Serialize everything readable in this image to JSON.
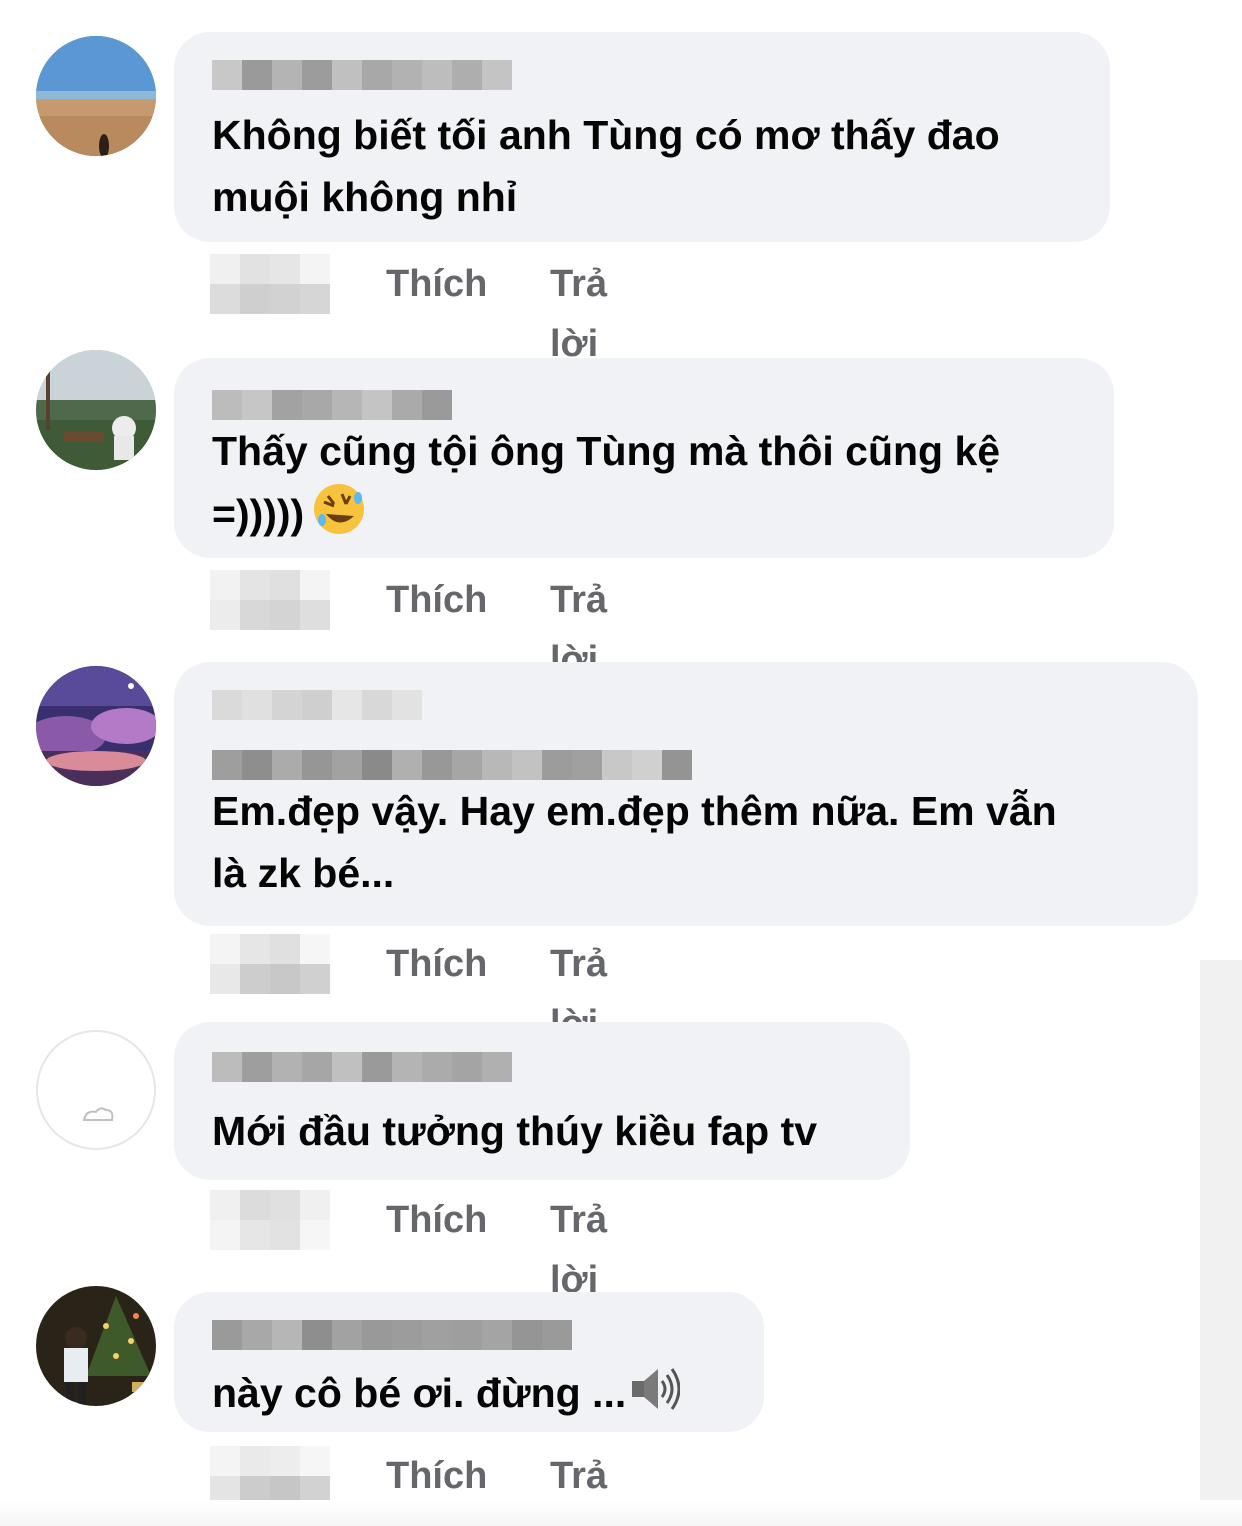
{
  "comments": [
    {
      "author": "",
      "text": "Không biết tối anh Tùng có mơ thấy đao\nmuội không nhỉ",
      "like_label": "Thích",
      "reply_label": "Trả lời"
    },
    {
      "author": "",
      "text": "Thấy cũng tội ông Tùng mà thôi cũng kệ\n=)))))",
      "emoji": "rolling-on-floor-laughing-emoji",
      "like_label": "Thích",
      "reply_label": "Trả lời"
    },
    {
      "author": "",
      "text": "Em.đẹp vậy. Hay em.đẹp thêm nữa. Em vẫn\nlà zk bé...",
      "like_label": "Thích",
      "reply_label": "Trả lời"
    },
    {
      "author": "",
      "text": "Mới đầu tưởng thúy kiều fap tv",
      "like_label": "Thích",
      "reply_label": "Trả lời"
    },
    {
      "author": "",
      "text": "này cô bé ơi. đừng ...",
      "emoji": "speaker-icon",
      "like_label": "Thích",
      "reply_label": "Trả lời"
    }
  ],
  "colors": {
    "bubble": "#f0f2f5",
    "text": "#050505",
    "action": "#65676b"
  }
}
